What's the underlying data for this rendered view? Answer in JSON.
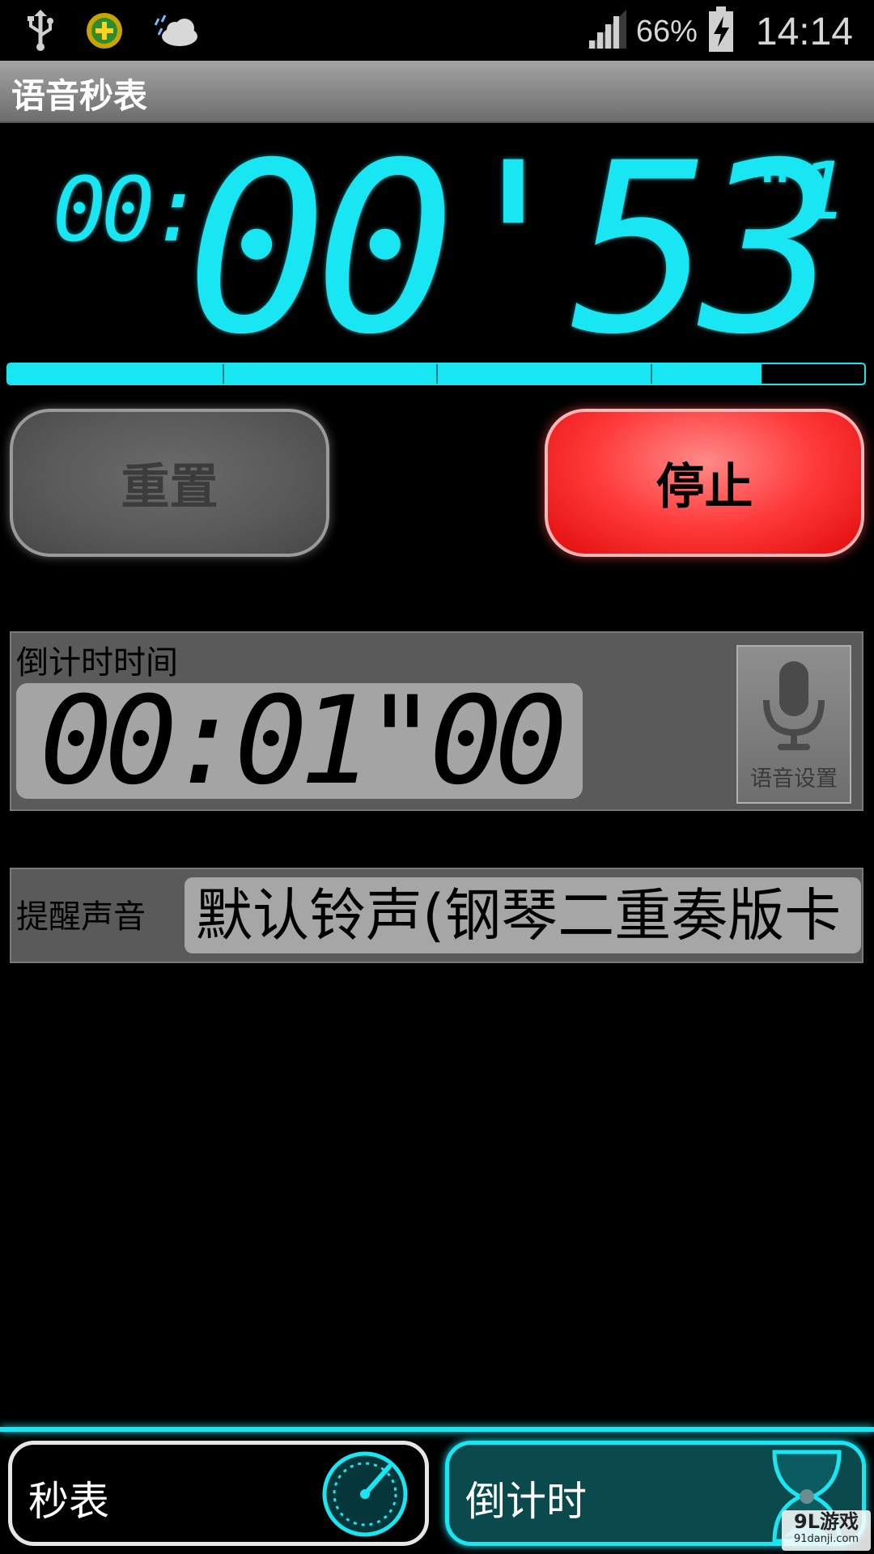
{
  "status_bar": {
    "signal_percent": "66%",
    "time": "14:14",
    "icons": [
      "usb-icon",
      "app-plus-icon",
      "weather-icon",
      "signal-icon",
      "battery-charging-icon"
    ]
  },
  "app": {
    "title": "语音秒表"
  },
  "stopwatch": {
    "hours": "00:",
    "main": "00'53",
    "tenths": "\"1",
    "progress_fraction": 0.88
  },
  "buttons": {
    "reset": "重置",
    "stop": "停止"
  },
  "countdown": {
    "label": "倒计时时间",
    "time": "00:01\"00",
    "voice_settings": "语音设置"
  },
  "alarm": {
    "label": "提醒声音",
    "value": "默认铃声(钢琴二重奏版卡"
  },
  "tabs": {
    "stopwatch": "秒表",
    "countdown": "倒计时"
  },
  "watermark": {
    "line1": "9L游戏",
    "line2": "91danji.com"
  },
  "colors": {
    "accent": "#19e6f3",
    "stop_red": "#ff3a3a",
    "panel_gray": "#5a5a5a"
  }
}
